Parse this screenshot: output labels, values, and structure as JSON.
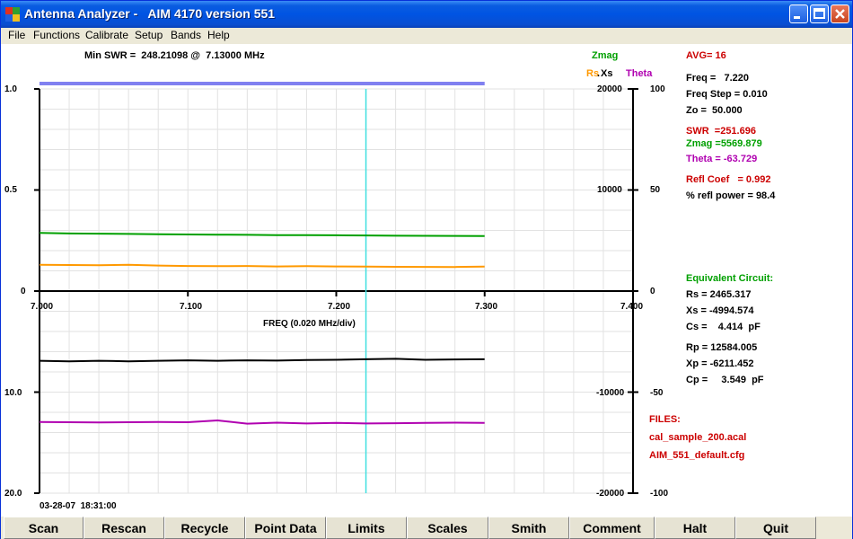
{
  "window": {
    "title": "Antenna Analyzer -   AIM 4170 version 551"
  },
  "menu": [
    "File",
    "Functions",
    "Calibrate",
    "Setup",
    "Bands",
    "Help"
  ],
  "header": {
    "min_swr": "Min SWR =  248.21098 @  7.13000 MHz"
  },
  "legend": {
    "zmag": "Zmag",
    "rs": "Rs",
    "dot": ".",
    "xs": "Xs",
    "theta": "Theta"
  },
  "axes": {
    "top_left": [
      "1.0",
      "0.5",
      "0"
    ],
    "top_right_z": [
      "20000",
      "10000"
    ],
    "top_right_deg": [
      "100",
      "50",
      "0"
    ],
    "bottom_left": [
      "10.0",
      "20.0"
    ],
    "bottom_right_z": [
      "-10000",
      "-20000"
    ],
    "bottom_right_deg": [
      "-50",
      "-100"
    ],
    "freq_ticks": [
      "7.000",
      "7.100",
      "7.200",
      "7.300",
      "7.400"
    ],
    "freq_label": "FREQ (0.020 MHz/div)"
  },
  "timestamp": "03-28-07  18:31:00",
  "readout": {
    "avg": "AVG= 16",
    "freq": "Freq =   7.220",
    "freq_step": "Freq Step = 0.010",
    "zo": "Zo =  50.000",
    "swr": "SWR  =251.696",
    "zmag": "Zmag =5569.879",
    "theta": "Theta = -63.729",
    "refl_coef": "Refl Coef   = 0.992",
    "refl_power": "% refl power = 98.4"
  },
  "equiv": {
    "title": "Equivalent Circuit:",
    "rs": "Rs = 2465.317",
    "xs": "Xs = -4994.574",
    "cs": "Cs =    4.414  pF",
    "rp": "Rp = 12584.005",
    "xp": "Xp = -6211.452",
    "cp": "Cp =     3.549  pF"
  },
  "files": {
    "title": "FILES:",
    "cal": "cal_sample_200.acal",
    "cfg": "AIM_551_default.cfg"
  },
  "buttons": [
    "Scan",
    "Rescan",
    "Recycle",
    "Point Data",
    "Limits",
    "Scales",
    "Smith",
    "Comment",
    "Halt",
    "Quit"
  ],
  "colors": {
    "zmag": "#00a000",
    "rs": "#ff9900",
    "xs": "#000000",
    "theta": "#b000b0",
    "swr_bar": "#8080f0",
    "cursor": "#40e0e0",
    "red": "#cc0000"
  },
  "chart_data": {
    "type": "line",
    "x": [
      7.0,
      7.02,
      7.04,
      7.06,
      7.08,
      7.1,
      7.12,
      7.14,
      7.16,
      7.18,
      7.2,
      7.22,
      7.24,
      7.26,
      7.28,
      7.3
    ],
    "xlim": [
      7.0,
      7.4
    ],
    "cursor_x": 7.22,
    "series": [
      {
        "name": "Zmag",
        "axis": "ohms",
        "values": [
          5750,
          5700,
          5680,
          5650,
          5620,
          5600,
          5580,
          5560,
          5540,
          5530,
          5520,
          5500,
          5480,
          5470,
          5460,
          5450
        ]
      },
      {
        "name": "Rs",
        "axis": "ohms",
        "values": [
          2600,
          2580,
          2560,
          2600,
          2520,
          2480,
          2460,
          2480,
          2440,
          2460,
          2440,
          2420,
          2400,
          2390,
          2380,
          2420
        ]
      },
      {
        "name": "Xs",
        "axis": "ohms",
        "values": [
          -6900,
          -6950,
          -6900,
          -6950,
          -6900,
          -6850,
          -6900,
          -6850,
          -6880,
          -6820,
          -6800,
          -6750,
          -6700,
          -6800,
          -6760,
          -6750
        ]
      },
      {
        "name": "Theta",
        "axis": "deg",
        "values": [
          -64.8,
          -64.9,
          -65.0,
          -64.9,
          -64.8,
          -64.9,
          -64.0,
          -65.6,
          -65.1,
          -65.5,
          -65.2,
          -65.5,
          -65.4,
          -65.2,
          -65.1,
          -65.2
        ]
      }
    ],
    "swr_bar_level": 1.0,
    "ylim_ohms": [
      -20000,
      20000
    ],
    "ylim_deg": [
      -100,
      100
    ],
    "ylim_swr_top": [
      0,
      1.0
    ],
    "ylim_swr_bottom": [
      0,
      20.0
    ]
  }
}
